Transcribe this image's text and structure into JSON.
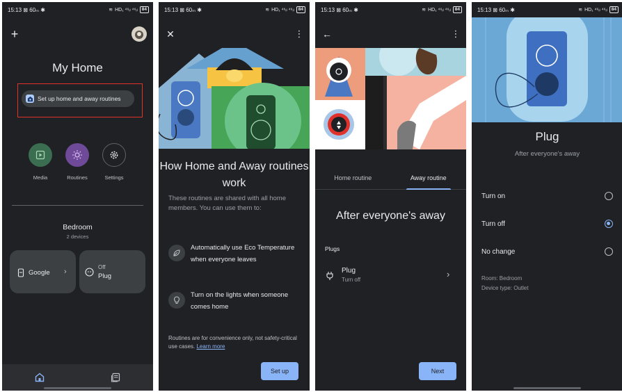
{
  "status": {
    "p1": {
      "time": "15:13",
      "left_icons": "⊠ 60ₘ ✱",
      "right": "HD₁ ⁴⁶ᵢₗ ⁴⁶ᵢₗ",
      "battery": "84"
    },
    "p2": {
      "time": "15:13",
      "left_icons": "⊠ 60ₘ ✱",
      "right": "HD₁ ⁴⁶ᵢₗ ⁴⁶ᵢₗ",
      "battery": "84"
    },
    "p3": {
      "time": "15:13",
      "left_icons": "⊠ 60ₘ ✱",
      "right": "HD₁ ⁴⁶ᵢₗ ⁴⁶ᵢₗ",
      "battery": "84"
    },
    "p4": {
      "time": "15:13",
      "left_icons": "⊠ 60ₘ ✱",
      "right": "HD₁ ⁴⁶ᵢₗ ⁴⁶ᵢₗ",
      "battery": "84"
    }
  },
  "screen1": {
    "title": "My Home",
    "setup_chip": "Set up home and away routines",
    "actions": [
      {
        "label": "Media",
        "icon": "play-icon",
        "color": "#3b6e51"
      },
      {
        "label": "Routines",
        "icon": "sun-icon",
        "color": "#6e4a99"
      },
      {
        "label": "Settings",
        "icon": "gear-icon",
        "color": "#202124"
      }
    ],
    "room": {
      "name": "Bedroom",
      "count": "2 devices"
    },
    "devices": [
      {
        "name": "Google"
      },
      {
        "state": "Off",
        "name": "Plug"
      }
    ],
    "nav": [
      "home-icon",
      "feed-icon"
    ]
  },
  "screen2": {
    "title": "How Home and Away routines work",
    "description": "These routines are shared with all home members. You can use them to:",
    "features": [
      {
        "icon": "leaf-icon",
        "text": "Automatically use Eco Temperature when everyone leaves"
      },
      {
        "icon": "bulb-icon",
        "text": "Turn on the lights when someone comes home"
      }
    ],
    "footer": "Routines are for convenience only, not safety-critical use cases.",
    "learn_more": "Learn more",
    "button": "Set up"
  },
  "screen3": {
    "tabs": [
      {
        "label": "Home routine",
        "active": false
      },
      {
        "label": "Away routine",
        "active": true
      }
    ],
    "title": "After everyone's away",
    "section": "Plugs",
    "device": {
      "name": "Plug",
      "status": "Turn off"
    },
    "button": "Next"
  },
  "screen4": {
    "title": "Plug",
    "subtitle": "After everyone's away",
    "options": [
      {
        "label": "Turn on",
        "selected": false
      },
      {
        "label": "Turn off",
        "selected": true
      },
      {
        "label": "No change",
        "selected": false
      }
    ],
    "room": "Room: Bedroom",
    "device_type": "Device type: Outlet"
  },
  "colors": {
    "accent": "#8ab4f8",
    "background": "#202124",
    "surface": "#3c4043",
    "highlight": "#e0312b"
  }
}
